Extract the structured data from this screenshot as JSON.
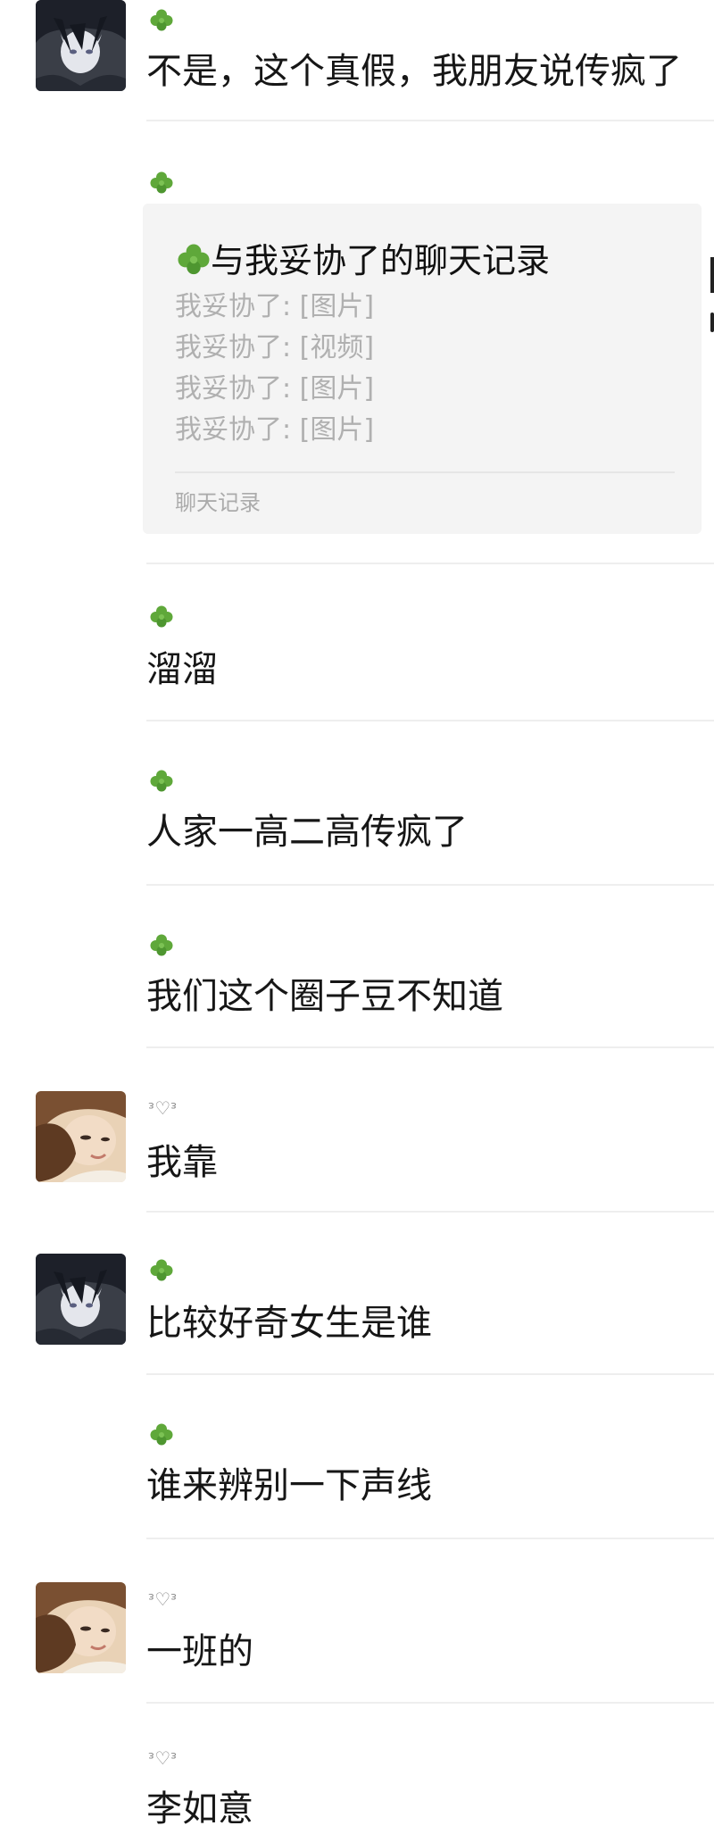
{
  "messages": [
    {
      "sender": "clover",
      "text": "不是，这个真假，我朋友说传疯了"
    },
    {
      "sender": "clover",
      "card": {
        "title": "与我妥协了的聊天记录",
        "lines": [
          "我妥协了: [图片]",
          "我妥协了: [视频]",
          "我妥协了: [图片]",
          "我妥协了: [图片]"
        ],
        "footer": "聊天记录"
      }
    },
    {
      "sender": "clover",
      "text": "溜溜"
    },
    {
      "sender": "clover",
      "text": "人家一高二高传疯了"
    },
    {
      "sender": "clover",
      "text": "我们这个圈子豆不知道"
    },
    {
      "sender": "cat",
      "nickname": "ᵌ♡ᵌ",
      "text": "我靠"
    },
    {
      "sender": "clover",
      "text": "比较好奇女生是谁"
    },
    {
      "sender": "clover",
      "text": "谁来辨别一下声线"
    },
    {
      "sender": "cat",
      "nickname": "ᵌ♡ᵌ",
      "text": "一班的"
    },
    {
      "sender": "cat",
      "nickname": "ᵌ♡ᵌ",
      "text": "李如意"
    }
  ],
  "colors": {
    "clover_green": "#5fa83a",
    "text": "#161616",
    "muted": "#b0b0b0",
    "card_bg": "#f4f4f4",
    "divider": "#eeeeee"
  },
  "icons": {
    "clover": "four-leaf-clover-icon",
    "boy_avatar": "anime-boy-avatar",
    "girl_avatar": "girl-photo-avatar"
  }
}
